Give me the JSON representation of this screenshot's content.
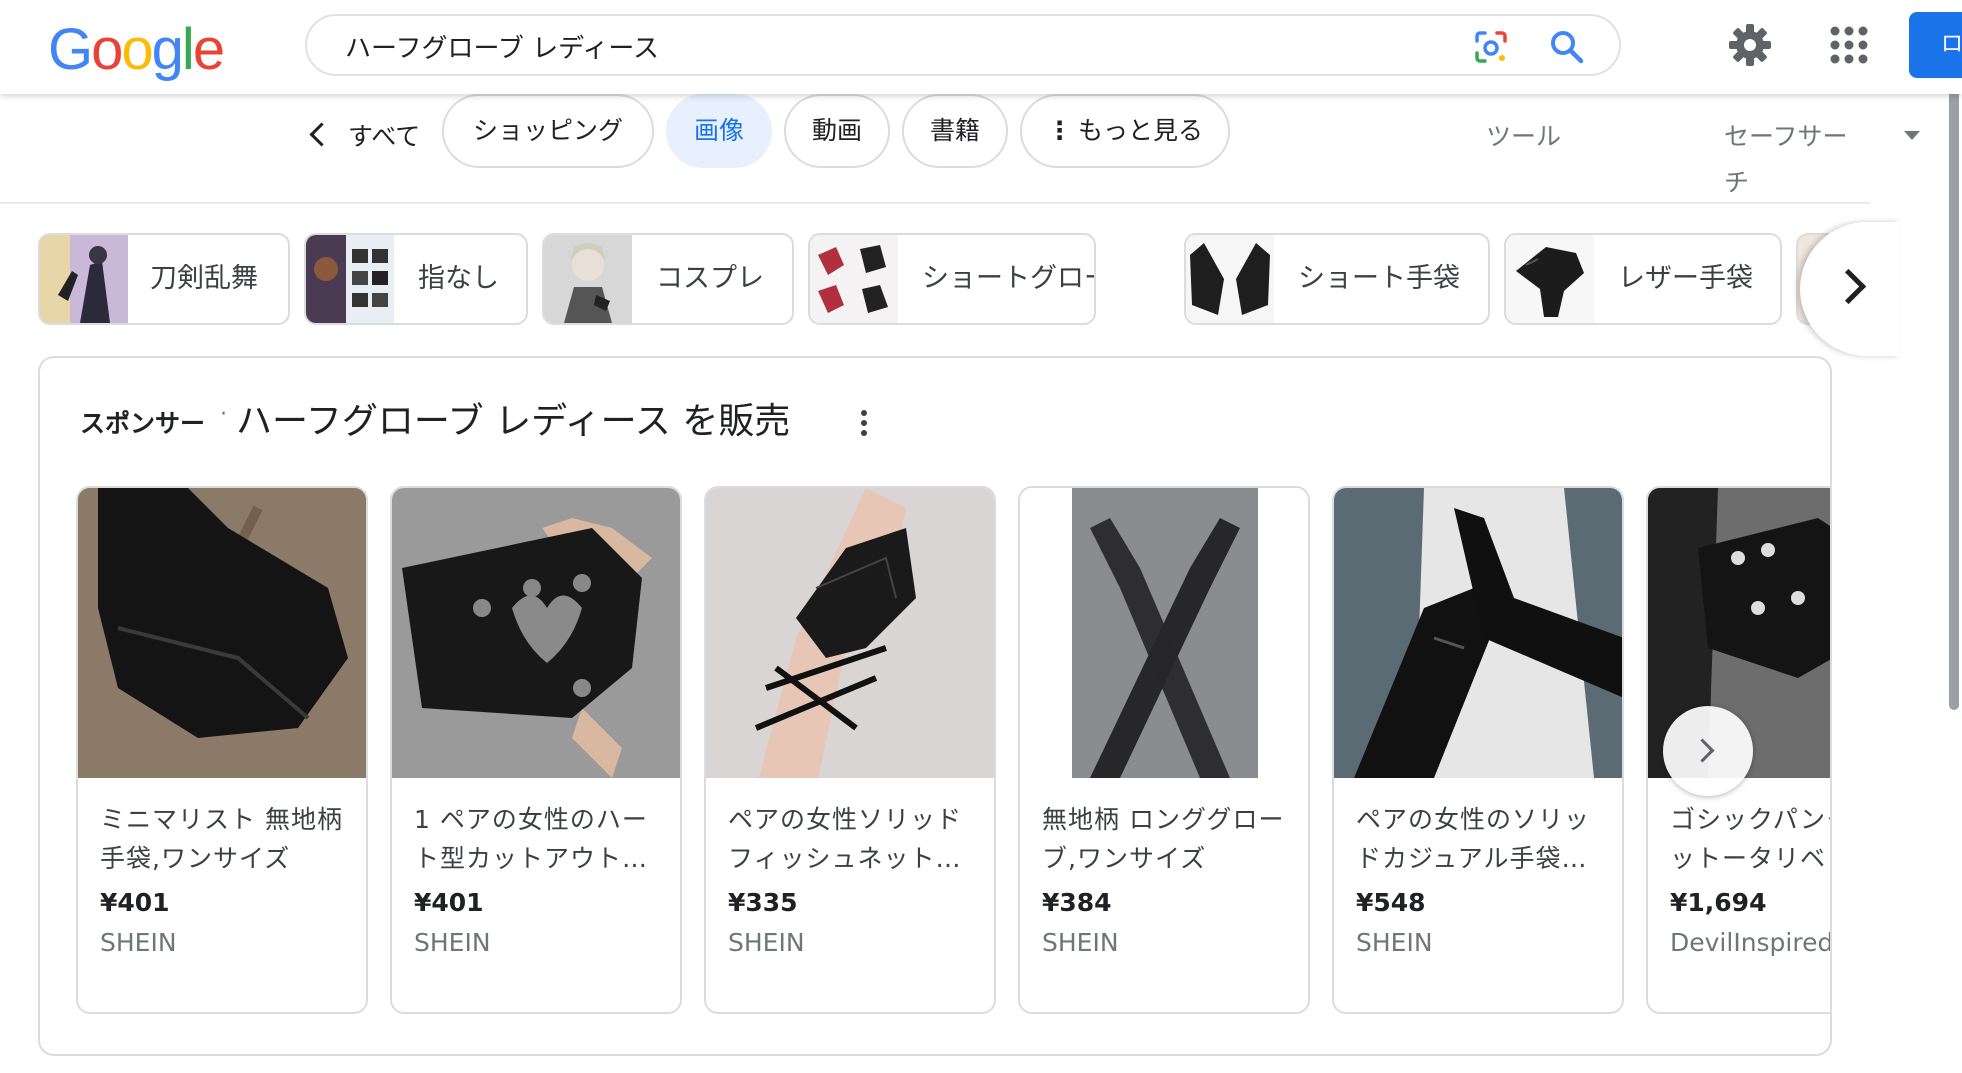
{
  "header": {
    "logo_letters": [
      "G",
      "o",
      "o",
      "g",
      "l",
      "e"
    ],
    "logo_colors": [
      "#4285F4",
      "#EA4335",
      "#FBBC05",
      "#4285F4",
      "#34A853",
      "#EA4335"
    ],
    "search_query": "ハーフグローブ レディース",
    "lens_icon": "google-lens-icon",
    "search_icon": "magnifier-icon",
    "settings_icon": "gear-icon",
    "apps_icon": "grid-apps-icon",
    "signin_label": "ロ"
  },
  "tabs": {
    "back_label": "すべて",
    "items": [
      {
        "label": "ショッピング",
        "active": false
      },
      {
        "label": "画像",
        "active": true
      },
      {
        "label": "動画",
        "active": false
      },
      {
        "label": "書籍",
        "active": false
      },
      {
        "label": "もっと見る",
        "active": false
      }
    ],
    "tools_label": "ツール",
    "safesearch_label": "セーフサーチ"
  },
  "related_chips": [
    {
      "label": "刀剣乱舞"
    },
    {
      "label": "指なし"
    },
    {
      "label": "コスプレ"
    },
    {
      "label": "ショートグローブ"
    },
    {
      "label": "ショート手袋"
    },
    {
      "label": "レザー手袋"
    }
  ],
  "sponsored": {
    "label": "スポンサー",
    "separator": "·",
    "title": "ハーフグローブ レディース を販売",
    "products": [
      {
        "name": "ミニマリスト 無地柄 手袋,ワンサイズ",
        "price": "¥401",
        "store": "SHEIN"
      },
      {
        "name": "1 ペアの女性のハート型カットアウト…",
        "price": "¥401",
        "store": "SHEIN"
      },
      {
        "name": "ペアの女性ソリッドフィッシュネット…",
        "price": "¥335",
        "store": "SHEIN"
      },
      {
        "name": "無地柄 ロンググローブ,ワンサイズ",
        "price": "¥384",
        "store": "SHEIN"
      },
      {
        "name": "ペアの女性のソリッドカジュアル手袋…",
        "price": "¥548",
        "store": "SHEIN"
      },
      {
        "name": "ゴシックパンクリベットータリベット",
        "price": "¥1,694",
        "store": "DevilInspired"
      }
    ]
  },
  "colors": {
    "accent": "#1a73e8",
    "active_tab_bg": "#e8f0fe",
    "border": "#dadce0"
  }
}
